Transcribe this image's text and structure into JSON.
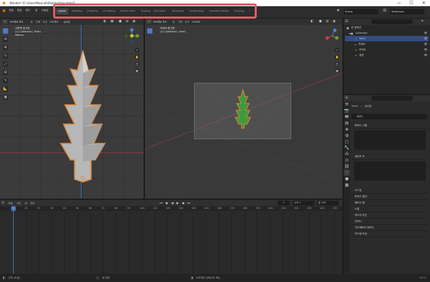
{
  "window": {
    "title": "Blender* [C:\\Users\\Musical\\Desktop\\tree.blend]",
    "controls": [
      "—",
      "☐",
      "✕"
    ]
  },
  "menu": [
    "파일",
    "편집",
    "렌더",
    "창",
    "도움말"
  ],
  "workspaces": [
    "Layout",
    "Modeling",
    "Sculpting",
    "UV Editing",
    "Texture Paint",
    "Shading",
    "Animation",
    "Rendering",
    "Compositing",
    "Geometry Nodes",
    "Scripting"
  ],
  "scene": {
    "label": "Scene",
    "view_layer": "ViewLayer"
  },
  "viewport_left": {
    "mode": "오브젝트 모드",
    "menus": [
      "뷰",
      "선택",
      "추가",
      "오브젝트"
    ],
    "transform": "글로벌",
    "info_line1": "오른쪽 정사영",
    "info_line2": "(1) Collection | Tree1",
    "info_line3": "Meters"
  },
  "viewport_right": {
    "mode": "오브젝트 모드",
    "menus": [
      "뷰",
      "선택",
      "추가",
      "오브젝트"
    ],
    "info_line1": "카메라 원근법",
    "info_line2": "(1) Collection | Tree1"
  },
  "outliner": {
    "root": "씬 컬렉션",
    "items": [
      "Collection",
      "Tree1",
      "카메라",
      "라이트",
      "광원"
    ]
  },
  "properties": {
    "object_name": "Tree1",
    "data_tab": "글로벌",
    "modifier": "트리1",
    "sections": [
      "버텍스 그룹",
      "셰이프 키",
      "UV 맵",
      "버텍스 컬러",
      "페이스 맵",
      "노멀",
      "텍스처 공간",
      "리메시",
      "지오메트리 데이터",
      "커스텀 속성"
    ]
  },
  "timeline": {
    "menus": [
      "재생",
      "키잉",
      "뷰",
      "마커"
    ],
    "current_frame": "1",
    "start_label": "시작",
    "start": "1",
    "end_label": "끝",
    "end": "250",
    "ticks": [
      "0",
      "10",
      "20",
      "30",
      "40",
      "50",
      "60",
      "70",
      "80",
      "90",
      "100",
      "110",
      "120",
      "130",
      "140",
      "150",
      "160",
      "170",
      "180",
      "190",
      "200",
      "210",
      "220",
      "230",
      "240",
      "250"
    ]
  },
  "statusbar": {
    "left": "선택 (토글)",
    "middle": "뷰 회전",
    "right": "오브젝트 컨텍스트 메뉴",
    "version": "3.1.2"
  }
}
